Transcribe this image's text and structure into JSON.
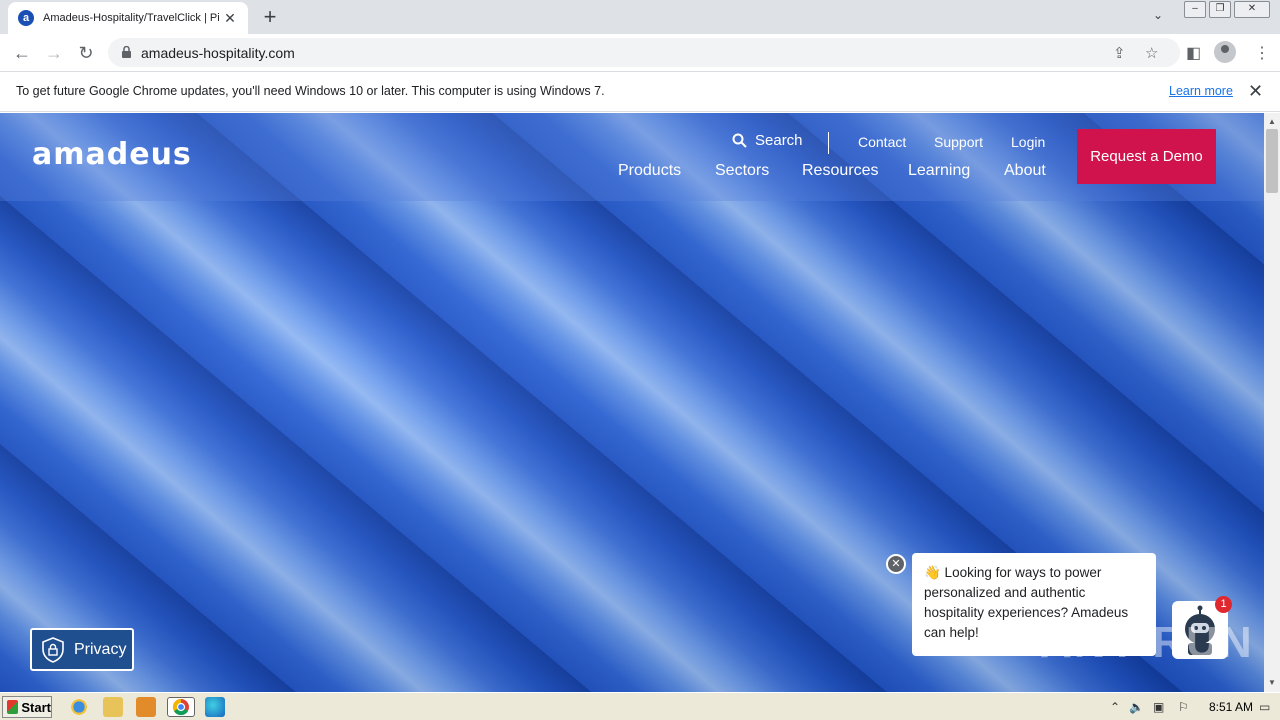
{
  "browser": {
    "tab_title": "Amadeus-Hospitality/TravelClick | Pic",
    "tab_favicon_letter": "a",
    "url": "amadeus-hospitality.com",
    "infobar_text": "To get future Google Chrome updates, you'll need Windows 10 or later. This computer is using Windows 7.",
    "infobar_link": "Learn more"
  },
  "site": {
    "logo": "amadeus",
    "search_label": "Search",
    "util_links": [
      "Contact",
      "Support",
      "Login"
    ],
    "main_nav": [
      "Products",
      "Sectors",
      "Resources",
      "Learning",
      "About"
    ],
    "cta": "Request a Demo",
    "privacy_label": "Privacy",
    "chat_message": "👋 Looking for ways to power personalized and authentic hospitality experiences? Amadeus can help!",
    "chat_badge": "1",
    "brand_color": "#d0134d"
  },
  "watermark": "ANY RUN",
  "taskbar": {
    "start_label": "Start",
    "clock": "8:51 AM"
  }
}
